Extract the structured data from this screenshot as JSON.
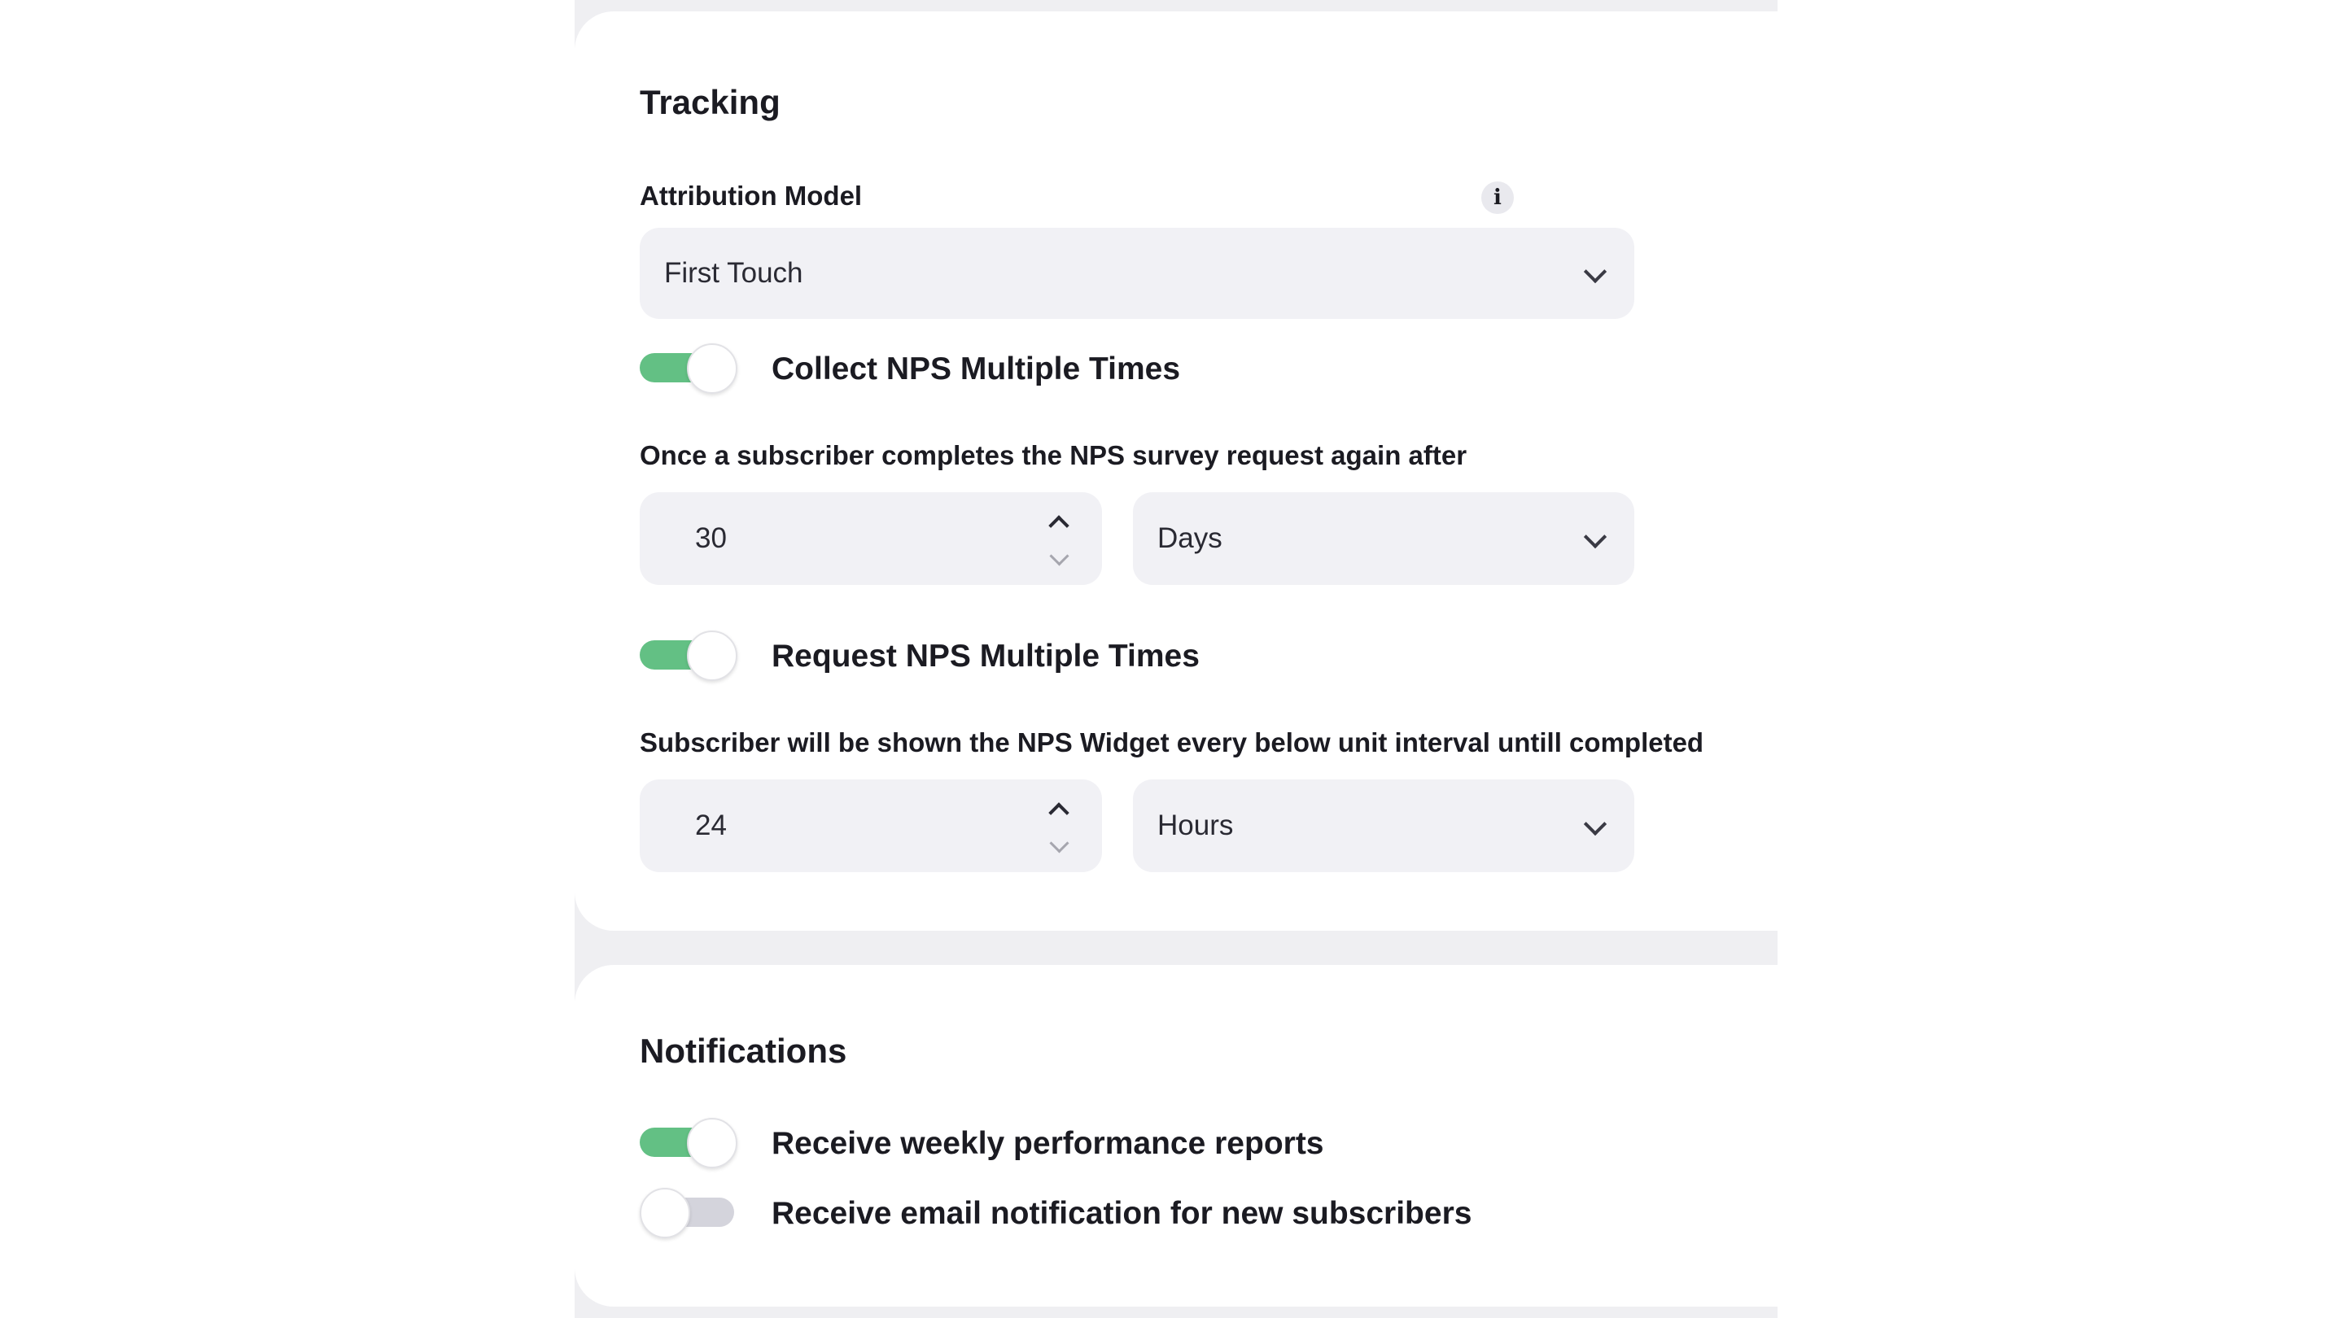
{
  "tracking": {
    "title": "Tracking",
    "attribution_label": "Attribution Model",
    "info_icon": "i",
    "attribution_value": "First Touch",
    "collect_toggle": {
      "label": "Collect NPS Multiple Times",
      "on": true
    },
    "collect_description": "Once a subscriber completes the NPS survey request again after",
    "collect_interval": {
      "value": "30",
      "unit": "Days"
    },
    "request_toggle": {
      "label": "Request NPS Multiple Times",
      "on": true
    },
    "request_description": "Subscriber will be shown the NPS Widget every below unit interval untill completed",
    "request_interval": {
      "value": "24",
      "unit": "Hours"
    }
  },
  "notifications": {
    "title": "Notifications",
    "weekly_reports": {
      "label": "Receive weekly performance reports",
      "on": true
    },
    "new_subscribers": {
      "label": "Receive email notification for new subscribers",
      "on": false
    }
  },
  "colors": {
    "toggle_on": "#63c084",
    "toggle_off": "#d4d4dc",
    "input_bg": "#f1f1f5",
    "page_bg": "#efeff2"
  }
}
